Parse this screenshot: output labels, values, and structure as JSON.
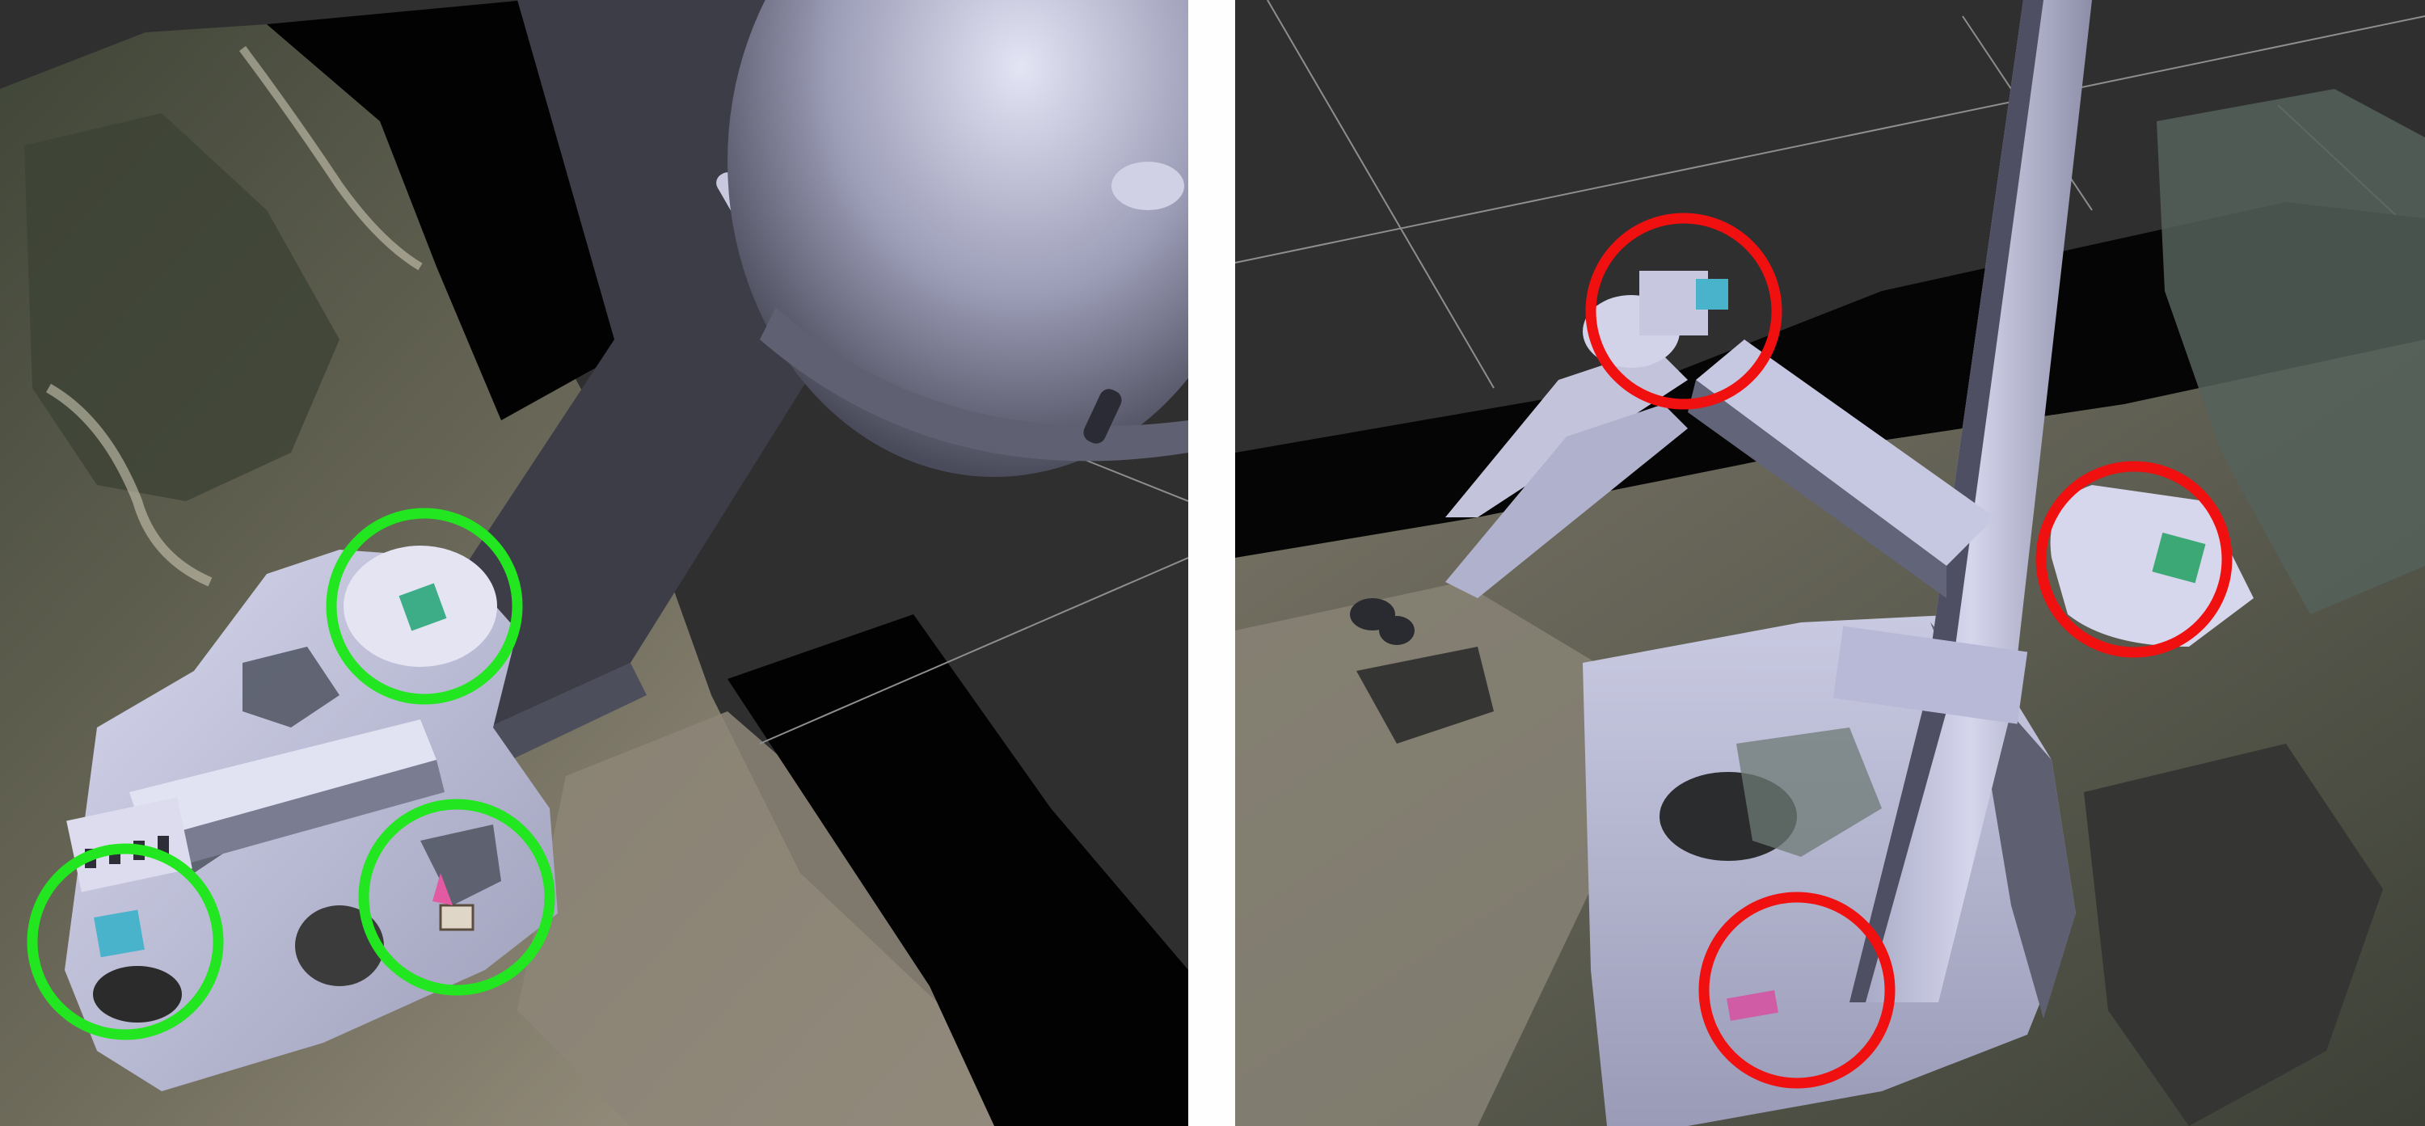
{
  "colors": {
    "background": "#2f2f30",
    "grid": "#8e8e8e",
    "void": "#020202",
    "floor_light": "#8f887d",
    "floor_dark": "#4d4f43",
    "robot_body": "#b8b9d8",
    "robot_shadow": "#5d6070",
    "left_markers": "#22e61f",
    "right_markers": "#f01010",
    "divider": "#ffffff"
  },
  "panels": [
    {
      "name": "left-view",
      "view": "top-down",
      "marker_color": "green",
      "marker_count": 3
    },
    {
      "name": "right-view",
      "view": "perspective",
      "marker_color": "red",
      "marker_count": 3
    }
  ],
  "icons": [
    "green-circle-marker",
    "red-circle-marker"
  ]
}
